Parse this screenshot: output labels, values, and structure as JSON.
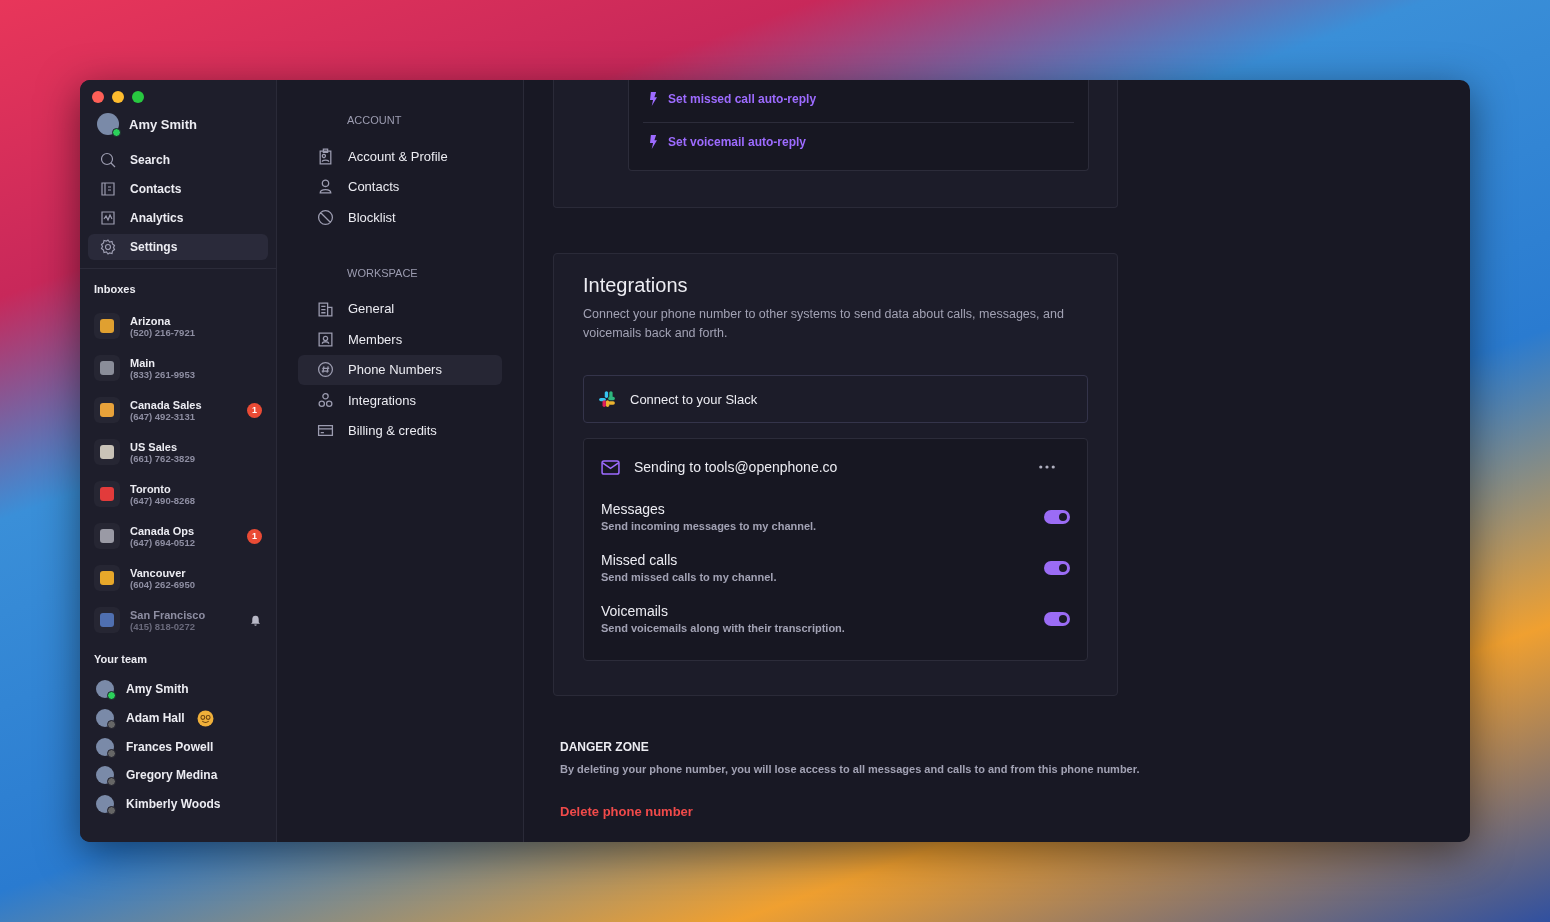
{
  "user": {
    "name": "Amy Smith",
    "online": true
  },
  "nav": [
    {
      "label": "Search",
      "selected": false
    },
    {
      "label": "Contacts",
      "selected": false
    },
    {
      "label": "Analytics",
      "selected": false
    },
    {
      "label": "Settings",
      "selected": true
    }
  ],
  "inboxes_title": "Inboxes",
  "inboxes": [
    {
      "name": "Arizona",
      "number": "(520) 216-7921",
      "muted": false,
      "color": "#e0a030"
    },
    {
      "name": "Main",
      "number": "(833) 261-9953",
      "muted": false,
      "color": "#8a8d99"
    },
    {
      "name": "Canada Sales",
      "number": "(647) 492-3131",
      "unread": "1",
      "muted": false,
      "color": "#e8a23a"
    },
    {
      "name": "US Sales",
      "number": "(661) 762-3829",
      "muted": false,
      "color": "#c9c3b8"
    },
    {
      "name": "Toronto",
      "number": "(647) 490-8268",
      "muted": false,
      "color": "#e23b3b"
    },
    {
      "name": "Canada Ops",
      "number": "(647) 694-0512",
      "unread": "1",
      "muted": false,
      "color": "#9a9aa5"
    },
    {
      "name": "Vancouver",
      "number": "(604) 262-6950",
      "muted": false,
      "color": "#e8a82a"
    },
    {
      "name": "San Francisco",
      "number": "(415) 818-0272",
      "muted": true,
      "color": "#4f6fb0"
    }
  ],
  "team_title": "Your team",
  "team": [
    {
      "name": "Amy Smith",
      "online": true,
      "status_emoji": false
    },
    {
      "name": "Adam Hall",
      "online": false,
      "status_emoji": true
    },
    {
      "name": "Frances Powell",
      "online": false,
      "status_emoji": false
    },
    {
      "name": "Gregory Medina",
      "online": false,
      "status_emoji": false
    },
    {
      "name": "Kimberly Woods",
      "online": false,
      "status_emoji": false
    }
  ],
  "settings_nav": [
    {
      "heading": "ACCOUNT",
      "items": [
        {
          "label": "Account & Profile",
          "selected": false
        },
        {
          "label": "Contacts",
          "selected": false
        },
        {
          "label": "Blocklist",
          "selected": false
        }
      ]
    },
    {
      "heading": "WORKSPACE",
      "items": [
        {
          "label": "General",
          "selected": false
        },
        {
          "label": "Members",
          "selected": false
        },
        {
          "label": "Phone Numbers",
          "selected": true
        },
        {
          "label": "Integrations",
          "selected": false
        },
        {
          "label": "Billing & credits",
          "selected": false
        }
      ]
    }
  ],
  "auto_replies": [
    "Set missed call auto-reply",
    "Set voicemail auto-reply"
  ],
  "integrations": {
    "title": "Integrations",
    "description": "Connect your phone number to other systems to send data about calls, messages, and voicemails back and forth.",
    "slack_button": "Connect to your Slack",
    "email_integration": {
      "title": "Sending to tools@openphone.co",
      "options": [
        {
          "title": "Messages",
          "description": "Send incoming messages to my channel.",
          "on": true
        },
        {
          "title": "Missed calls",
          "description": "Send missed calls to my channel.",
          "on": true
        },
        {
          "title": "Voicemails",
          "description": "Send voicemails along with their transcription.",
          "on": true
        }
      ]
    }
  },
  "danger_zone": {
    "title": "DANGER ZONE",
    "description": "By deleting your phone number, you will lose access to all messages and calls to and from this phone number.",
    "action": "Delete phone number"
  }
}
